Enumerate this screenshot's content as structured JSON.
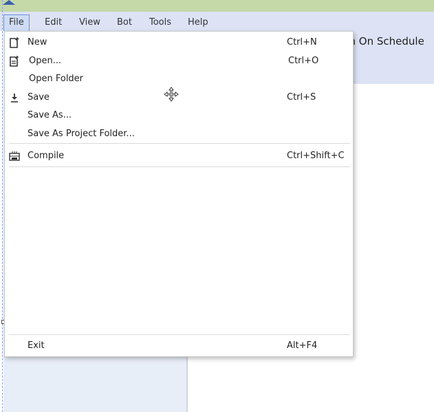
{
  "menubar": {
    "items": [
      {
        "label": "File"
      },
      {
        "label": "Edit"
      },
      {
        "label": "View"
      },
      {
        "label": "Bot"
      },
      {
        "label": "Tools"
      },
      {
        "label": "Help"
      }
    ]
  },
  "ribbon": {
    "run_on_schedule_label": "un On Schedule"
  },
  "file_menu": {
    "new": {
      "label": "New",
      "shortcut": "Ctrl+N"
    },
    "open": {
      "label": "Open...",
      "shortcut": "Ctrl+O"
    },
    "open_folder": {
      "label": "Open Folder"
    },
    "save": {
      "label": "Save",
      "shortcut": "Ctrl+S"
    },
    "save_as": {
      "label": "Save As..."
    },
    "save_as_project_folder": {
      "label": "Save As Project Folder..."
    },
    "compile": {
      "label": "Compile",
      "shortcut": "Ctrl+Shift+C"
    },
    "exit": {
      "label": "Exit",
      "shortcut": "Alt+F4"
    }
  }
}
